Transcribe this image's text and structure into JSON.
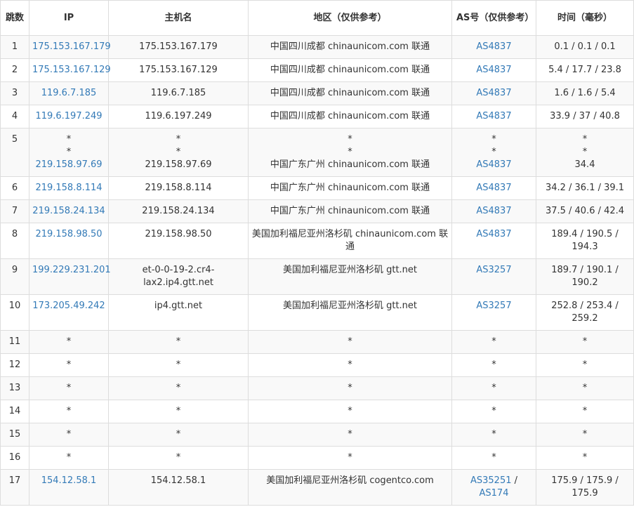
{
  "table": {
    "headers": {
      "hop": "跳数",
      "ip": "IP",
      "hostname": "主机名",
      "region": "地区（仅供参考）",
      "asn": "AS号（仅供参考）",
      "time": "时间（毫秒）"
    },
    "rows": [
      {
        "hop": "1",
        "ip": [
          "175.153.167.179"
        ],
        "host": [
          "175.153.167.179"
        ],
        "region": [
          "中国四川成都 chinaunicom.com 联通"
        ],
        "asn": [
          [
            "AS4837"
          ]
        ],
        "time": [
          "0.1 / 0.1 / 0.1"
        ]
      },
      {
        "hop": "2",
        "ip": [
          "175.153.167.129"
        ],
        "host": [
          "175.153.167.129"
        ],
        "region": [
          "中国四川成都 chinaunicom.com 联通"
        ],
        "asn": [
          [
            "AS4837"
          ]
        ],
        "time": [
          "5.4 / 17.7 / 23.8"
        ]
      },
      {
        "hop": "3",
        "ip": [
          "119.6.7.185"
        ],
        "host": [
          "119.6.7.185"
        ],
        "region": [
          "中国四川成都 chinaunicom.com 联通"
        ],
        "asn": [
          [
            "AS4837"
          ]
        ],
        "time": [
          "1.6 / 1.6 / 5.4"
        ]
      },
      {
        "hop": "4",
        "ip": [
          "119.6.197.249"
        ],
        "host": [
          "119.6.197.249"
        ],
        "region": [
          "中国四川成都 chinaunicom.com 联通"
        ],
        "asn": [
          [
            "AS4837"
          ]
        ],
        "time": [
          "33.9 / 37 / 40.8"
        ]
      },
      {
        "hop": "5",
        "ip": [
          "*",
          "*",
          "219.158.97.69"
        ],
        "host": [
          "*",
          "*",
          "219.158.97.69"
        ],
        "region": [
          "*",
          "*",
          "中国广东广州 chinaunicom.com 联通"
        ],
        "asn": [
          [
            "*"
          ],
          [
            "*"
          ],
          [
            "AS4837"
          ]
        ],
        "time": [
          "*",
          "*",
          "34.4"
        ]
      },
      {
        "hop": "6",
        "ip": [
          "219.158.8.114"
        ],
        "host": [
          "219.158.8.114"
        ],
        "region": [
          "中国广东广州 chinaunicom.com 联通"
        ],
        "asn": [
          [
            "AS4837"
          ]
        ],
        "time": [
          "34.2 / 36.1 / 39.1"
        ]
      },
      {
        "hop": "7",
        "ip": [
          "219.158.24.134"
        ],
        "host": [
          "219.158.24.134"
        ],
        "region": [
          "中国广东广州 chinaunicom.com 联通"
        ],
        "asn": [
          [
            "AS4837"
          ]
        ],
        "time": [
          "37.5 / 40.6 / 42.4"
        ]
      },
      {
        "hop": "8",
        "ip": [
          "219.158.98.50"
        ],
        "host": [
          "219.158.98.50"
        ],
        "region": [
          "美国加利福尼亚州洛杉矶 chinaunicom.com 联通"
        ],
        "asn": [
          [
            "AS4837"
          ]
        ],
        "time": [
          "189.4 / 190.5 / 194.3"
        ]
      },
      {
        "hop": "9",
        "ip": [
          "199.229.231.201"
        ],
        "host": [
          "et-0-0-19-2.cr4-lax2.ip4.gtt.net"
        ],
        "region": [
          "美国加利福尼亚州洛杉矶 gtt.net"
        ],
        "asn": [
          [
            "AS3257"
          ]
        ],
        "time": [
          "189.7 / 190.1 / 190.2"
        ]
      },
      {
        "hop": "10",
        "ip": [
          "173.205.49.242"
        ],
        "host": [
          "ip4.gtt.net"
        ],
        "region": [
          "美国加利福尼亚州洛杉矶 gtt.net"
        ],
        "asn": [
          [
            "AS3257"
          ]
        ],
        "time": [
          "252.8 / 253.4 / 259.2"
        ]
      },
      {
        "hop": "11",
        "ip": [
          "*"
        ],
        "host": [
          "*"
        ],
        "region": [
          "*"
        ],
        "asn": [
          [
            "*"
          ]
        ],
        "time": [
          "*"
        ]
      },
      {
        "hop": "12",
        "ip": [
          "*"
        ],
        "host": [
          "*"
        ],
        "region": [
          "*"
        ],
        "asn": [
          [
            "*"
          ]
        ],
        "time": [
          "*"
        ]
      },
      {
        "hop": "13",
        "ip": [
          "*"
        ],
        "host": [
          "*"
        ],
        "region": [
          "*"
        ],
        "asn": [
          [
            "*"
          ]
        ],
        "time": [
          "*"
        ]
      },
      {
        "hop": "14",
        "ip": [
          "*"
        ],
        "host": [
          "*"
        ],
        "region": [
          "*"
        ],
        "asn": [
          [
            "*"
          ]
        ],
        "time": [
          "*"
        ]
      },
      {
        "hop": "15",
        "ip": [
          "*"
        ],
        "host": [
          "*"
        ],
        "region": [
          "*"
        ],
        "asn": [
          [
            "*"
          ]
        ],
        "time": [
          "*"
        ]
      },
      {
        "hop": "16",
        "ip": [
          "*"
        ],
        "host": [
          "*"
        ],
        "region": [
          "*"
        ],
        "asn": [
          [
            "*"
          ]
        ],
        "time": [
          "*"
        ]
      },
      {
        "hop": "17",
        "ip": [
          "154.12.58.1"
        ],
        "host": [
          "154.12.58.1"
        ],
        "region": [
          "美国加利福尼亚州洛杉矶 cogentco.com"
        ],
        "asn": [
          [
            "AS35251",
            "AS174"
          ]
        ],
        "time": [
          "175.9 / 175.9 / 175.9"
        ]
      }
    ]
  },
  "colors": {
    "link": "#337ab7",
    "text": "#333333",
    "border": "#dddddd",
    "stripe": "#f9f9f9"
  }
}
